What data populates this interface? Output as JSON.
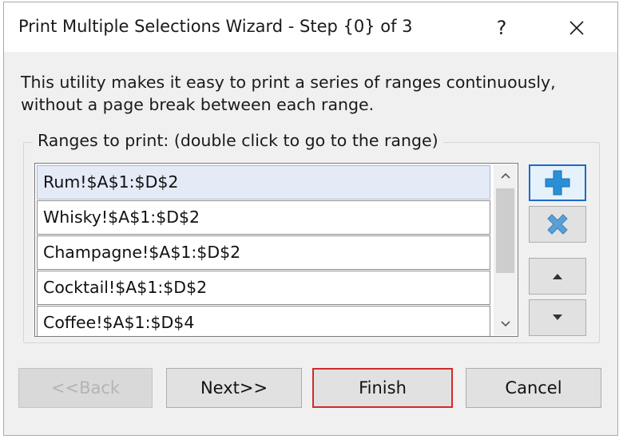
{
  "window": {
    "title": "Print Multiple Selections Wizard - Step {0} of 3",
    "help_glyph": "?",
    "close_glyph": "✕"
  },
  "description": {
    "line1": "This utility makes it easy to print a series of ranges continuously,",
    "line2": "without a page break between each range."
  },
  "ranges_group": {
    "label": "Ranges to print: (double click to go to the range)",
    "items": [
      {
        "label": "Rum!$A$1:$D$2",
        "selected": true
      },
      {
        "label": "Whisky!$A$1:$D$2",
        "selected": false
      },
      {
        "label": "Champagne!$A$1:$D$2",
        "selected": false
      },
      {
        "label": "Cocktail!$A$1:$D$2",
        "selected": false
      },
      {
        "label": "Coffee!$A$1:$D$4",
        "selected": false
      }
    ]
  },
  "side_buttons": [
    {
      "name": "add-range-button",
      "icon": "plus-icon",
      "color": "#2b8fd6"
    },
    {
      "name": "delete-range-button",
      "icon": "x-icon",
      "color": "#5aa0d8"
    },
    {
      "name": "move-up-button",
      "icon": "triangle-up-icon"
    },
    {
      "name": "move-down-button",
      "icon": "triangle-down-icon"
    }
  ],
  "footer": {
    "back_label": "<<Back",
    "next_label": "Next>>",
    "finish_label": "Finish",
    "cancel_label": "Cancel"
  },
  "colors": {
    "dialog_bg": "#f0f0f0",
    "selection_bg": "#e4ebf7",
    "focus_border": "#1f6ac9",
    "default_button_border": "#d12b2b"
  }
}
